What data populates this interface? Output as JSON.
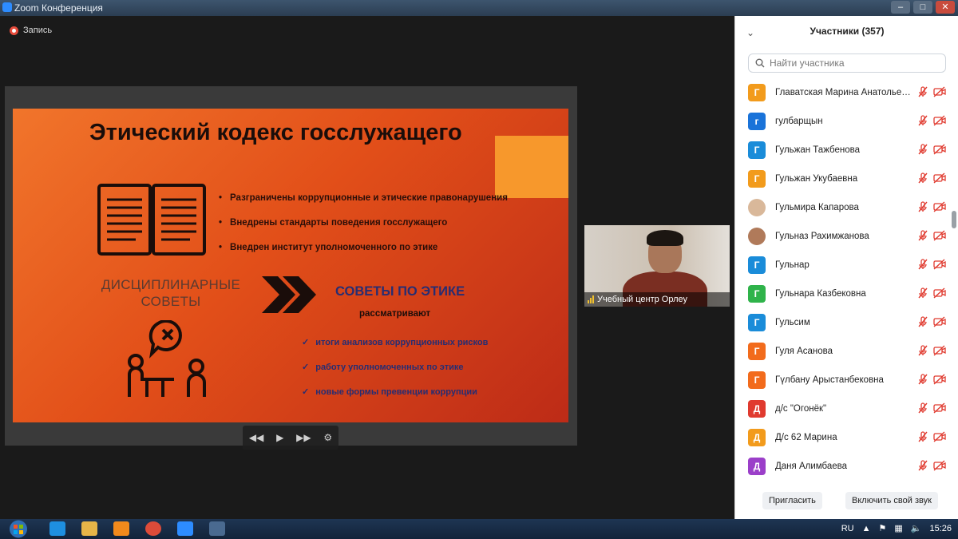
{
  "window": {
    "title": "Zoom Конференция"
  },
  "recording": {
    "label": "Запись"
  },
  "slide": {
    "title": "Этический кодекс госслужащего",
    "bullets": [
      "Разграничены коррупционные и этические правонарушения",
      "Внедрены стандарты поведения госслужащего",
      "Внедрен институт уполномоченного по этике"
    ],
    "disc_line1": "ДИСЦИПЛИНАРНЫЕ",
    "disc_line2": "СОВЕТЫ",
    "sovety": "СОВЕТЫ ПО ЭТИКЕ",
    "rassmatrivayut": "рассматривают",
    "checks": [
      "итоги анализов коррупционных рисков",
      "работу уполномоченных по этике",
      "новые формы превенции коррупции"
    ],
    "controls": {
      "prev": "◀◀",
      "play": "▶",
      "next": "▶▶",
      "settings": "⚙"
    }
  },
  "video": {
    "name": "Учебный центр Орлеу"
  },
  "participants": {
    "title": "Участники (357)",
    "search_placeholder": "Найти участника",
    "items": [
      {
        "initial": "Г",
        "color": "#f29b1c",
        "name": "Главатская Марина Анатольевна"
      },
      {
        "initial": "г",
        "color": "#1a73d9",
        "name": "гулбарщын"
      },
      {
        "initial": "Г",
        "color": "#1a8cd9",
        "name": "Гульжан Тажбенова"
      },
      {
        "initial": "Г",
        "color": "#f29b1c",
        "name": "Гульжан Укубаевна"
      },
      {
        "initial": "",
        "color": "#d9b89a",
        "name": "Гульмира Капарова"
      },
      {
        "initial": "",
        "color": "#b07a5a",
        "name": "Гульназ Рахимжанова"
      },
      {
        "initial": "Г",
        "color": "#1a8cd9",
        "name": "Гульнар"
      },
      {
        "initial": "Г",
        "color": "#2fb34a",
        "name": "Гульнара Казбековна"
      },
      {
        "initial": "Г",
        "color": "#1a8cd9",
        "name": "Гульсим"
      },
      {
        "initial": "Г",
        "color": "#f26b1c",
        "name": "Гуля Асанова"
      },
      {
        "initial": "Г",
        "color": "#f26b1c",
        "name": "Гүлбану Арыстанбековна"
      },
      {
        "initial": "Д",
        "color": "#e03a2f",
        "name": "д/с \"Огонёк\""
      },
      {
        "initial": "Д",
        "color": "#f29b1c",
        "name": "Д/с 62 Марина"
      },
      {
        "initial": "Д",
        "color": "#9b3fc9",
        "name": "Даня Алимбаева"
      }
    ],
    "invite": "Пригласить",
    "unmute": "Включить свой звук"
  },
  "taskbar": {
    "lang": "RU",
    "time": "15:26"
  },
  "colors": {
    "muted_icon": "#e03a2f",
    "accent": "#2d8cff"
  }
}
